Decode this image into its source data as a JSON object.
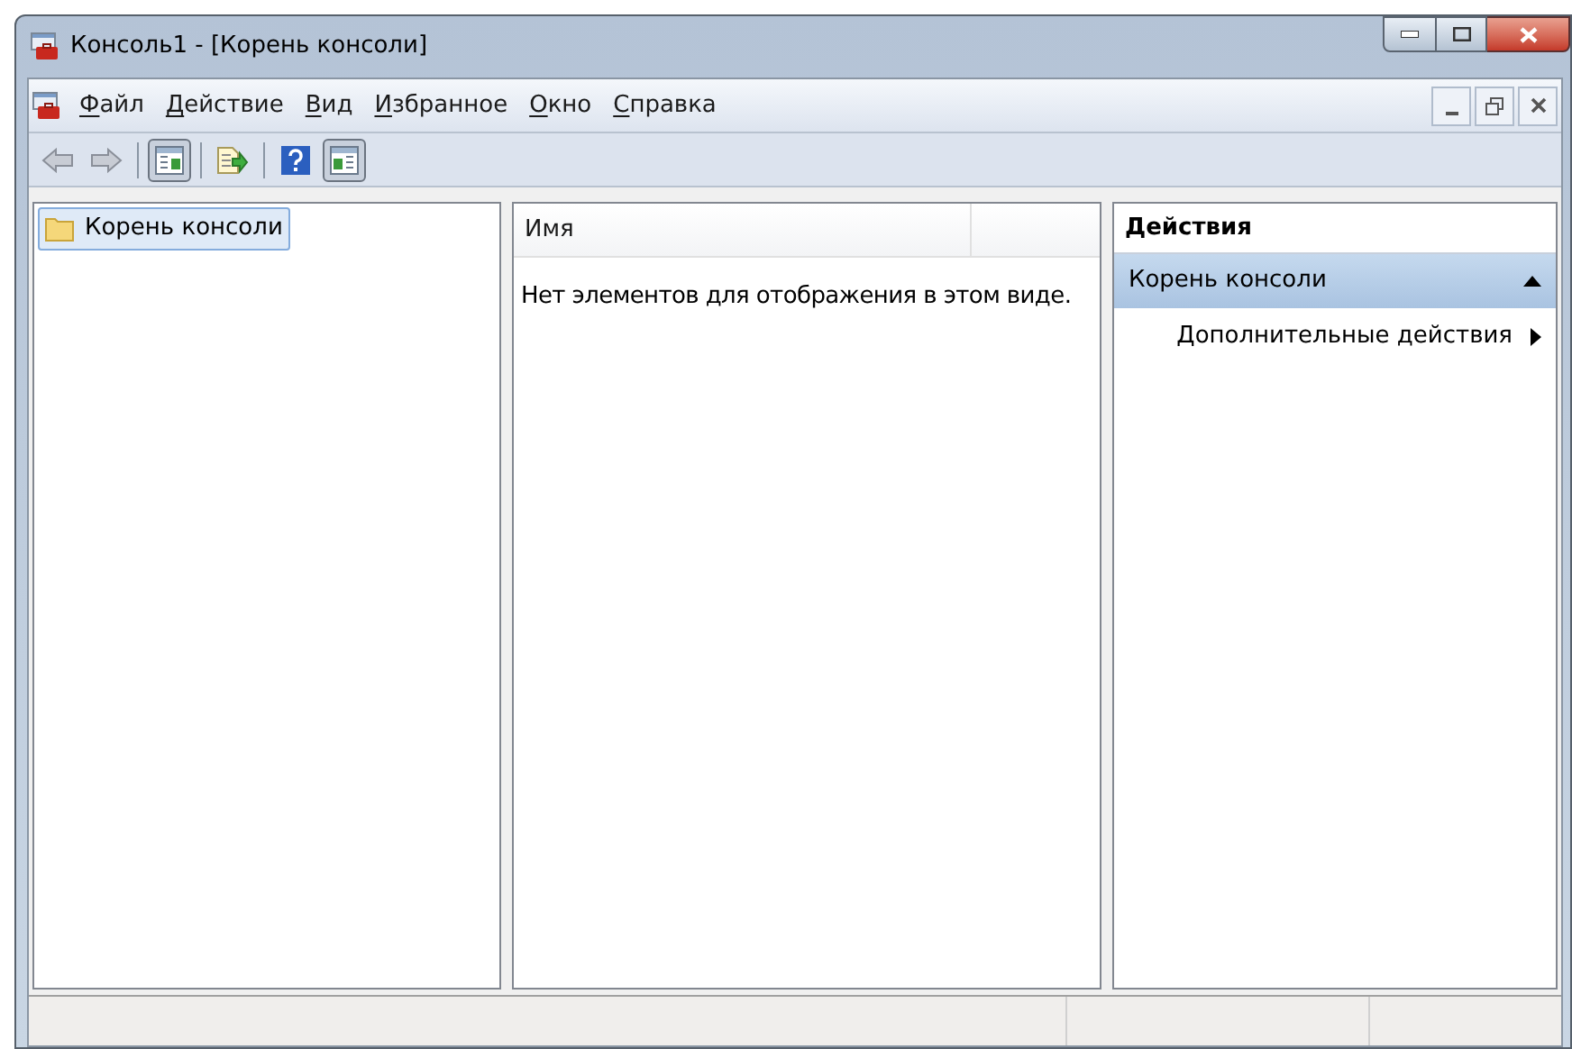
{
  "window": {
    "title": "Консоль1 - [Корень консоли]"
  },
  "menu": [
    {
      "label": "Файл"
    },
    {
      "label": "Действие"
    },
    {
      "label": "Вид"
    },
    {
      "label": "Избранное"
    },
    {
      "label": "Окно"
    },
    {
      "label": "Справка"
    }
  ],
  "toolbar": [
    {
      "kind": "back",
      "pressed": false
    },
    {
      "kind": "forward",
      "pressed": false
    },
    {
      "kind": "separator"
    },
    {
      "kind": "tree",
      "pressed": true
    },
    {
      "kind": "separator"
    },
    {
      "kind": "export",
      "pressed": false
    },
    {
      "kind": "separator"
    },
    {
      "kind": "help",
      "pressed": false
    },
    {
      "kind": "actions",
      "pressed": true
    }
  ],
  "tree": {
    "items": [
      {
        "label": "Корень консоли",
        "selected": true
      }
    ]
  },
  "list": {
    "columns": [
      "Имя"
    ],
    "empty_text": "Нет элементов для отображения в этом виде."
  },
  "actions": {
    "title": "Действия",
    "sections": [
      {
        "label": "Корень консоли",
        "expanded": true,
        "items": [
          {
            "label": "Дополнительные действия"
          }
        ]
      }
    ]
  }
}
